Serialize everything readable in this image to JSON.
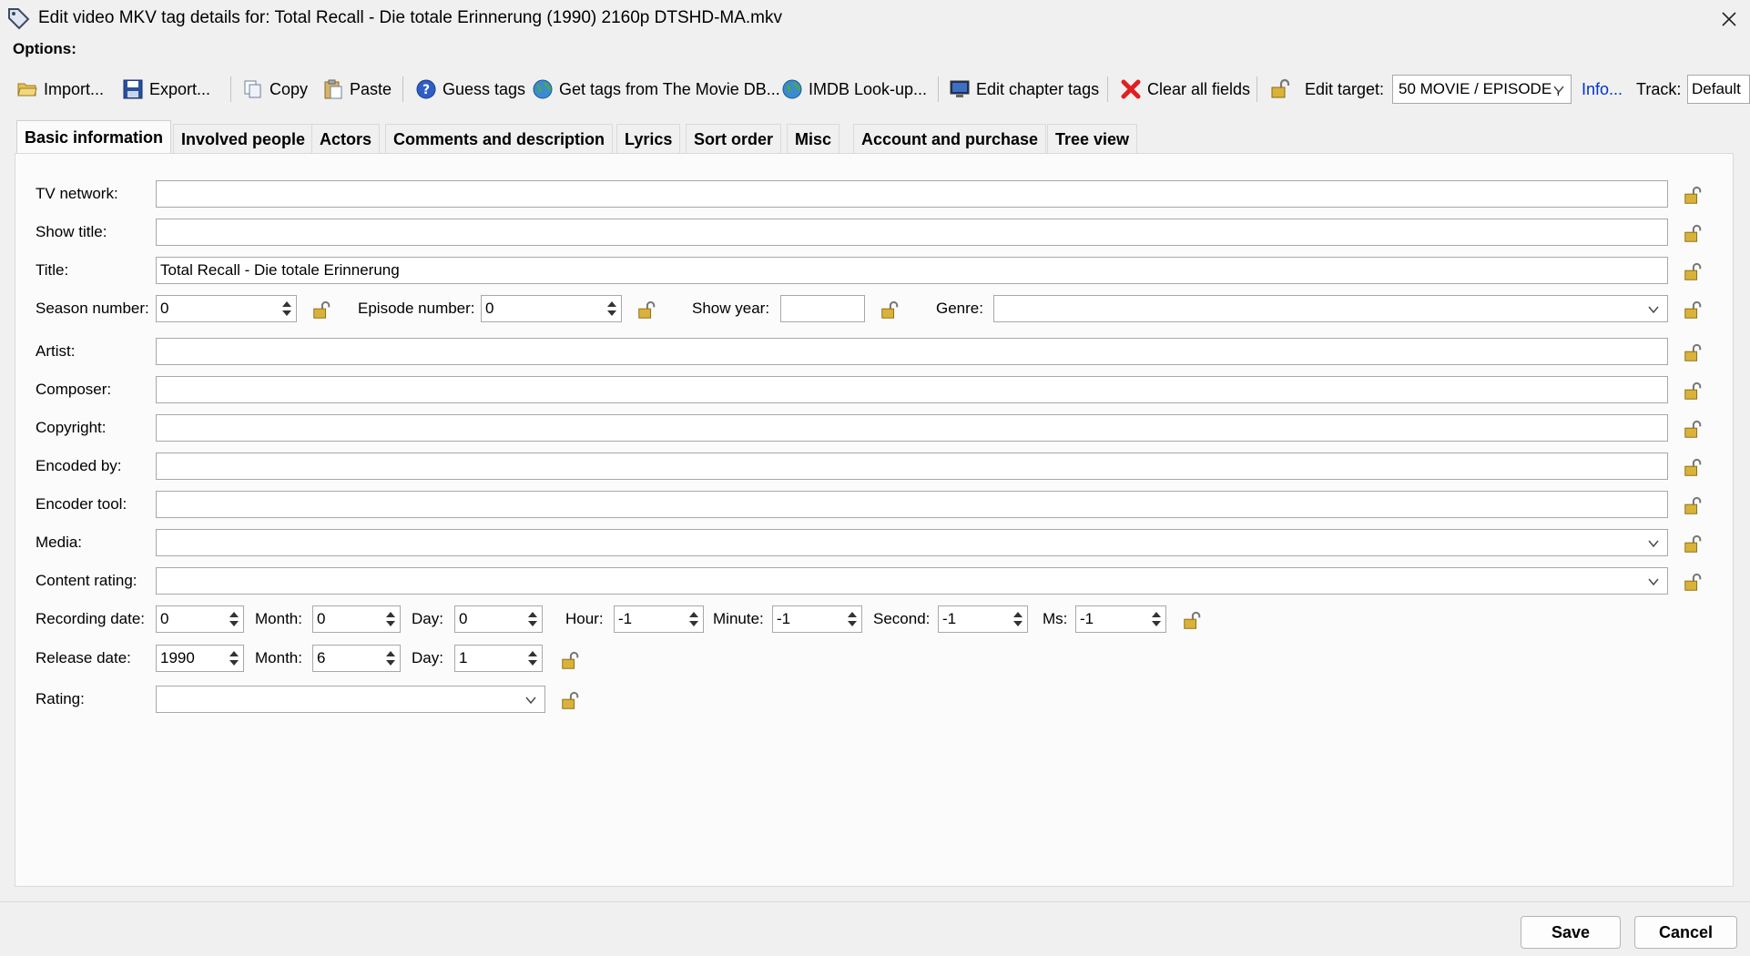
{
  "window": {
    "title": "Edit video MKV tag details for: Total Recall - Die totale Erinnerung (1990) 2160p DTSHD-MA.mkv",
    "close_icon": "close-icon"
  },
  "options_label": "Options:",
  "toolbar": {
    "import": "Import...",
    "export": "Export...",
    "copy": "Copy",
    "paste": "Paste",
    "guess_tags": "Guess tags",
    "movie_db": "Get tags from The Movie DB...",
    "imdb": "IMDB Look-up...",
    "chapter_tags": "Edit chapter tags",
    "clear_all": "Clear all fields",
    "edit_target_label": "Edit target:",
    "edit_target_value": "50 MOVIE / EPISODE ,",
    "info": "Info...",
    "track_label": "Track:",
    "track_value": "Default"
  },
  "tabs": [
    "Basic information",
    "Involved people",
    "Actors",
    "Comments and description",
    "Lyrics",
    "Sort order",
    "Misc",
    "Account and purchase",
    "Tree view"
  ],
  "active_tab": "Basic information",
  "form": {
    "tv_network": {
      "label": "TV network:",
      "value": ""
    },
    "show_title": {
      "label": "Show title:",
      "value": ""
    },
    "title": {
      "label": "Title:",
      "value": "Total Recall - Die totale Erinnerung"
    },
    "season_number": {
      "label": "Season number:",
      "value": "0"
    },
    "episode_number": {
      "label": "Episode number:",
      "value": "0"
    },
    "show_year": {
      "label": "Show year:",
      "value": ""
    },
    "genre": {
      "label": "Genre:",
      "value": ""
    },
    "artist": {
      "label": "Artist:",
      "value": ""
    },
    "composer": {
      "label": "Composer:",
      "value": ""
    },
    "copyright": {
      "label": "Copyright:",
      "value": ""
    },
    "encoded_by": {
      "label": "Encoded by:",
      "value": ""
    },
    "encoder_tool": {
      "label": "Encoder tool:",
      "value": ""
    },
    "media": {
      "label": "Media:",
      "value": ""
    },
    "content_rating": {
      "label": "Content rating:",
      "value": ""
    },
    "recording_date": {
      "label": "Recording date:",
      "year": "0",
      "month_label": "Month:",
      "month": "0",
      "day_label": "Day:",
      "day": "0",
      "hour_label": "Hour:",
      "hour": "-1",
      "minute_label": "Minute:",
      "minute": "-1",
      "second_label": "Second:",
      "second": "-1",
      "ms_label": "Ms:",
      "ms": "-1"
    },
    "release_date": {
      "label": "Release date:",
      "year": "1990",
      "month_label": "Month:",
      "month": "6",
      "day_label": "Day:",
      "day": "1"
    },
    "rating": {
      "label": "Rating:",
      "value": ""
    }
  },
  "buttons": {
    "save": "Save",
    "cancel": "Cancel"
  },
  "colors": {
    "link": "#0033cc",
    "clear_icon": "#e02020",
    "lock": "#c9a227"
  }
}
